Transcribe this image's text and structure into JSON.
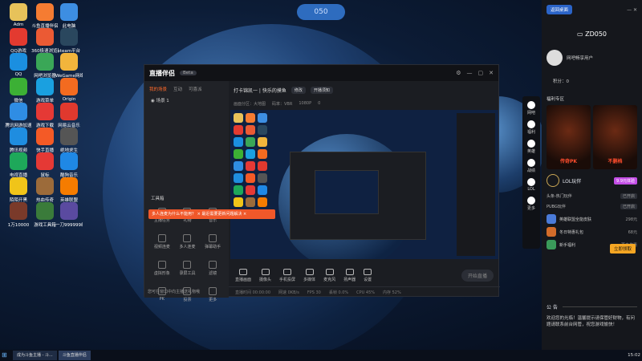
{
  "desktop": {
    "pill_label": "050",
    "icons": [
      {
        "name": "administrator",
        "label": "Adm",
        "color": "#e7c25a"
      },
      {
        "name": "douyu-streaming",
        "label": "斗鱼直播伴侣",
        "color": "#f57c32"
      },
      {
        "name": "pc",
        "label": "此电脑",
        "color": "#3d8ee2"
      },
      {
        "name": "qq-game",
        "label": "QQ游戏",
        "color": "#e33a30"
      },
      {
        "name": "360",
        "label": "360极速浏览器",
        "color": "#eb5a34"
      },
      {
        "name": "steam",
        "label": "steam平台",
        "color": "#2a475e"
      },
      {
        "name": "qq",
        "label": "QQ",
        "color": "#1b8fe0"
      },
      {
        "name": "chrome",
        "label": "网吧浏览器",
        "color": "#3aa757"
      },
      {
        "name": "wegame",
        "label": "WeGame网络",
        "color": "#f2b53c"
      },
      {
        "name": "wechat",
        "label": "微信",
        "color": "#3cb035"
      },
      {
        "name": "game-center",
        "label": "游戏菜单",
        "color": "#1aa0e0"
      },
      {
        "name": "origin",
        "label": "Origin",
        "color": "#f36b20"
      },
      {
        "name": "tencent-assistant",
        "label": "腾讯网游加速",
        "color": "#2f8de4"
      },
      {
        "name": "game-download",
        "label": "游戏下载",
        "color": "#e53935"
      },
      {
        "name": "netease-music",
        "label": "网易云音乐",
        "color": "#e0392e"
      },
      {
        "name": "video-player",
        "label": "腾讯视频",
        "color": "#1f8de0"
      },
      {
        "name": "kuaishou",
        "label": "快手直播",
        "color": "#f45a26"
      },
      {
        "name": "pubg",
        "label": "绝地求生",
        "color": "#555"
      },
      {
        "name": "tv-player",
        "label": "电视直播",
        "color": "#1ea85a"
      },
      {
        "name": "cursor-app",
        "label": "鼠标",
        "color": "#e53935"
      },
      {
        "name": "kugou",
        "label": "酷狗音乐",
        "color": "#1f88e5"
      },
      {
        "name": "game-house",
        "label": "陌陌开黑",
        "color": "#f0c419"
      },
      {
        "name": "poster",
        "label": "热血传奇",
        "color": "#9c6b3a"
      },
      {
        "name": "lol-client",
        "label": "英雄联盟",
        "color": "#f57c00"
      },
      {
        "name": "big-brother",
        "label": "1万10000",
        "color": "#7a3a2a"
      },
      {
        "name": "game-tool",
        "label": "游戏工具箱",
        "color": "#3a7b3a"
      },
      {
        "name": "moba",
        "label": "一刀999999级",
        "color": "#5a4aa0"
      }
    ]
  },
  "app": {
    "title": "直播伴侣",
    "version": "Beta",
    "left_tabs": [
      "我的场景",
      "互动",
      "可喜派"
    ],
    "scene": "场景 1",
    "toolbox_label": "工具箱",
    "notice_banner": "多人连麦为什么不能用？ ×  最近需要更新问题解决 ×",
    "tools": [
      "主播任务",
      "礼物",
      "音乐",
      "视频连麦",
      "多人连麦",
      "弹幕助手",
      "虚拟形象",
      "录屏工具",
      "滤镜",
      "PK",
      "投票",
      "更多"
    ],
    "footer_text": "您可在窗口中向主播送礼物哦",
    "stream_title": "打卡锦凯一 | 快乐的摸鱼",
    "stream_tag1": "修改",
    "stream_tag2": "开播须知",
    "info": [
      "画面分区：大地图",
      "码率：VBR",
      "1080P",
      "0"
    ],
    "controls": [
      "直播画面",
      "摄像头",
      "手机投屏",
      "多媒体",
      "麦克风",
      "扬声器",
      "设置"
    ],
    "start_button": "开始直播",
    "status": [
      "直播时间 00:00:00",
      "网速 0KB/s",
      "FPS 30",
      "丢帧 0.0%",
      "CPU 45%",
      "内存 52%"
    ]
  },
  "rail": [
    "网吧",
    "福利",
    "英雄",
    "战绩",
    "LOL",
    "更多"
  ],
  "right_panel": {
    "top_button": "返回桌面",
    "pc_name": "ZD050",
    "user": "网吧畅享用户",
    "points": "积分：0",
    "welfare_title": "福利专区",
    "promo": [
      "传奇PK",
      "不删档"
    ],
    "lol_title": "LOL玩伴",
    "lol_tag": "9.9元体验",
    "svc_rows": [
      {
        "name": "头条-热门玩伴",
        "status": "已开启"
      },
      {
        "name": "PUBG玩伴",
        "status": "已开启"
      }
    ],
    "offers": [
      {
        "name": "英雄联盟全能皮肤",
        "price": "298元",
        "color": "#4a7bd9"
      },
      {
        "name": "冬日特惠礼包",
        "price": "68元",
        "color": "#d36c2a"
      },
      {
        "name": "新手福利",
        "price": "更多优惠",
        "color": "#3a9a5a"
      }
    ],
    "unlock_label": "立即领取",
    "notice_title": "公 告",
    "notice_body": "欢迎您的光临！温馨提示请保管好财物，有问题请联系前台网管，祝您游戏愉快！"
  },
  "taskbar": {
    "tasks": [
      "成为斗鱼主播 - 斗...",
      "斗鱼直播伴侣"
    ],
    "time": "15:02"
  }
}
